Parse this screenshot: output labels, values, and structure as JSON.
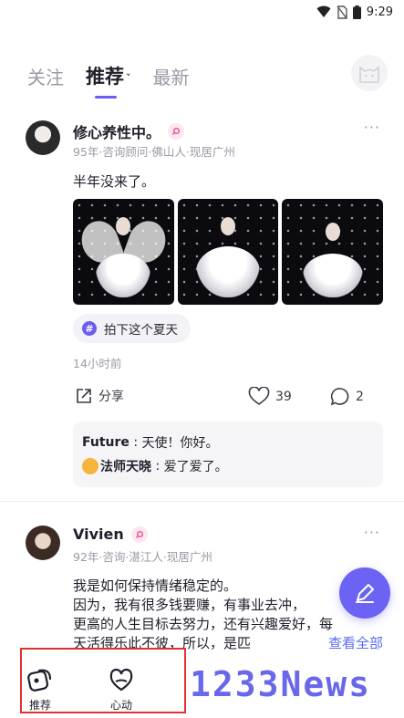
{
  "status": {
    "time": "9:29"
  },
  "tabs": [
    {
      "label": "关注",
      "active": false
    },
    {
      "label": "推荐",
      "active": true
    },
    {
      "label": "最新",
      "active": false
    }
  ],
  "accent_color": "#6c5cf0",
  "post1": {
    "username": "修心养性中。",
    "meta": "95年·咨询顾问·佛山人·现居广州",
    "text": "半年没来了。",
    "topic": "拍下这个夏天",
    "time": "14小时前",
    "share_label": "分享",
    "like_count": "39",
    "comment_count": "2",
    "comments": [
      {
        "name": "Future",
        "text": "天使！你好。"
      },
      {
        "name": "法师天晓",
        "text": "爱了爱了。"
      }
    ]
  },
  "post2": {
    "username": "Vivien",
    "meta": "92年·咨询·湛江人·现居广州",
    "lines": [
      "我是如何保持情绪稳定的。",
      "因为，我有很多钱要赚，有事业去冲，",
      "更高的人生目标去努力，还有兴趣爱好，每",
      "天活得乐此不彼，所以，是匹"
    ],
    "see_all": "查看全部"
  },
  "bottom_nav": [
    {
      "label": "推荐",
      "icon": "recommend-icon"
    },
    {
      "label": "心动",
      "icon": "heart-hands-icon"
    }
  ],
  "watermark": "1233News"
}
